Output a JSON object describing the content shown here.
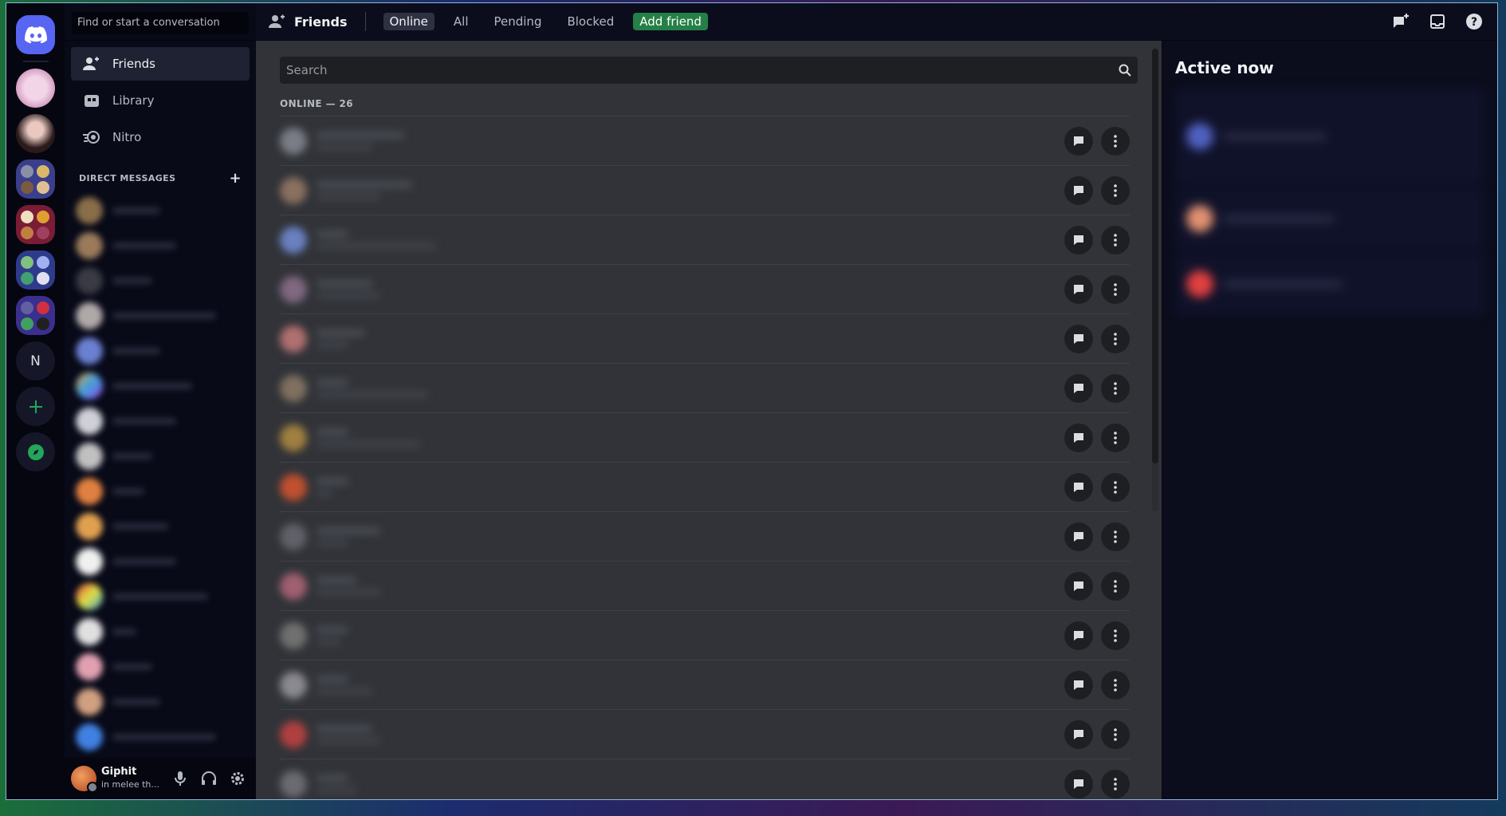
{
  "sidebar": {
    "search_placeholder": "Find or start a conversation",
    "nav": [
      {
        "label": "Friends",
        "icon": "friends-icon"
      },
      {
        "label": "Library",
        "icon": "library-icon"
      },
      {
        "label": "Nitro",
        "icon": "nitro-icon"
      }
    ],
    "dm_header": "DIRECT MESSAGES",
    "servers": {
      "letter_server": "N"
    }
  },
  "user": {
    "name": "Giphit",
    "status": "in melee th..."
  },
  "topbar": {
    "title": "Friends",
    "tabs": [
      "Online",
      "All",
      "Pending",
      "Blocked"
    ],
    "add_friend": "Add friend"
  },
  "friends": {
    "search_placeholder": "Search",
    "online_count": "ONLINE — 26"
  },
  "active_now": {
    "title": "Active now"
  },
  "colors": {
    "blurple": "#5865f2",
    "green": "#248046",
    "panel": "#313338"
  }
}
